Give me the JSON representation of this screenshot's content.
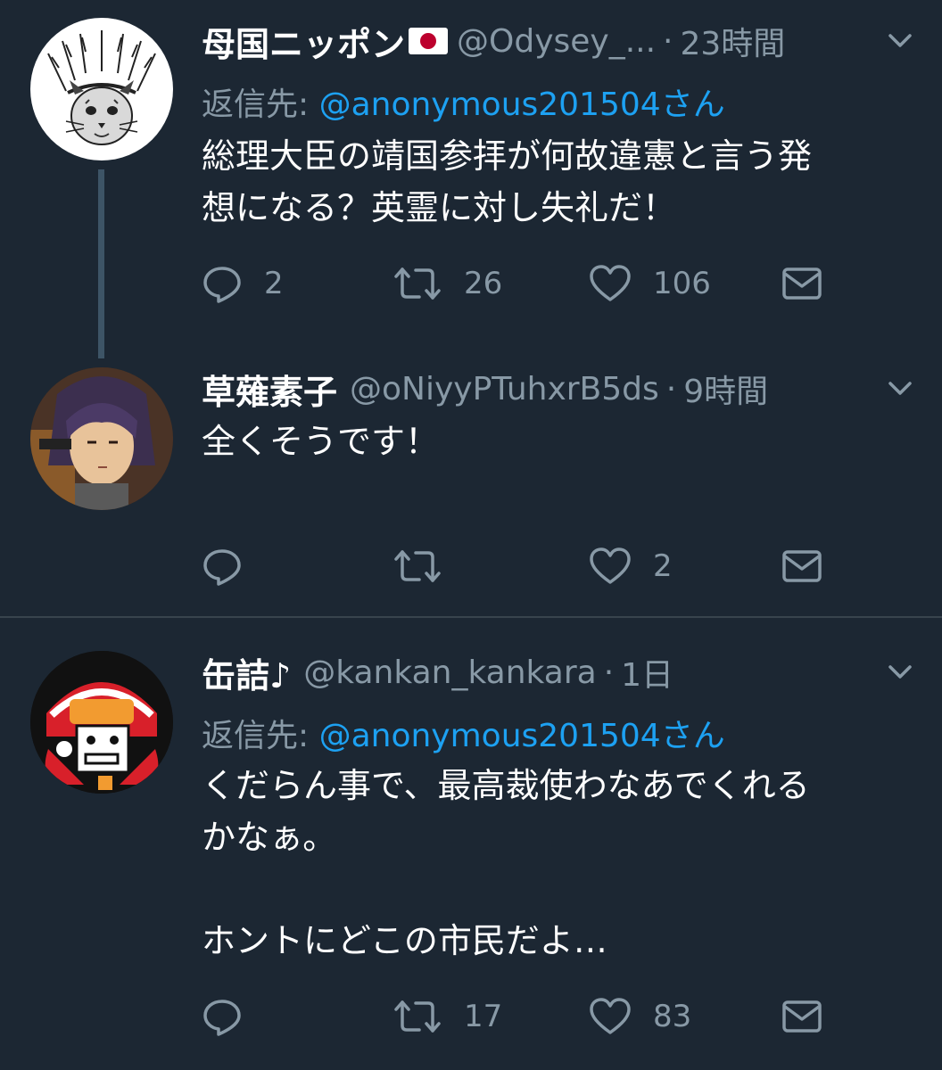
{
  "tweets": [
    {
      "display_name": "母国ニッポン",
      "handle": "@Odysey_...",
      "sep": "·",
      "time": "23時間",
      "reply_label": "返信先: ",
      "reply_mention": "@anonymous201504さん",
      "text_lines": [
        "総理大臣の靖国参拝が何故違憲と言う発",
        "想になる？英霊に対し失礼だ！"
      ],
      "replies": "2",
      "retweets": "26",
      "likes": "106"
    },
    {
      "display_name": "草薙素子",
      "handle": "@oNiyyPTuhxrB5ds",
      "sep": "·",
      "time": "9時間",
      "text_lines": [
        "全くそうです！"
      ],
      "replies": "",
      "retweets": "",
      "likes": "2"
    },
    {
      "display_name": "缶詰♪",
      "handle": "@kankan_kankara",
      "sep": "·",
      "time": "1日",
      "reply_label": "返信先: ",
      "reply_mention": "@anonymous201504さん",
      "text_lines": [
        "くだらん事で、最高裁使わなあでくれる",
        "かなぁ。",
        "",
        "ホントにどこの市民だよ…"
      ],
      "replies": "",
      "retweets": "17",
      "likes": "83"
    }
  ],
  "colors": {
    "background": "#1c2733",
    "secondary_text": "#8899a6",
    "link": "#1da1f2",
    "divider": "#38444d"
  },
  "icons": [
    "reply-icon",
    "retweet-icon",
    "like-icon",
    "dm-icon",
    "chevron-down-icon",
    "japan-flag-icon"
  ]
}
